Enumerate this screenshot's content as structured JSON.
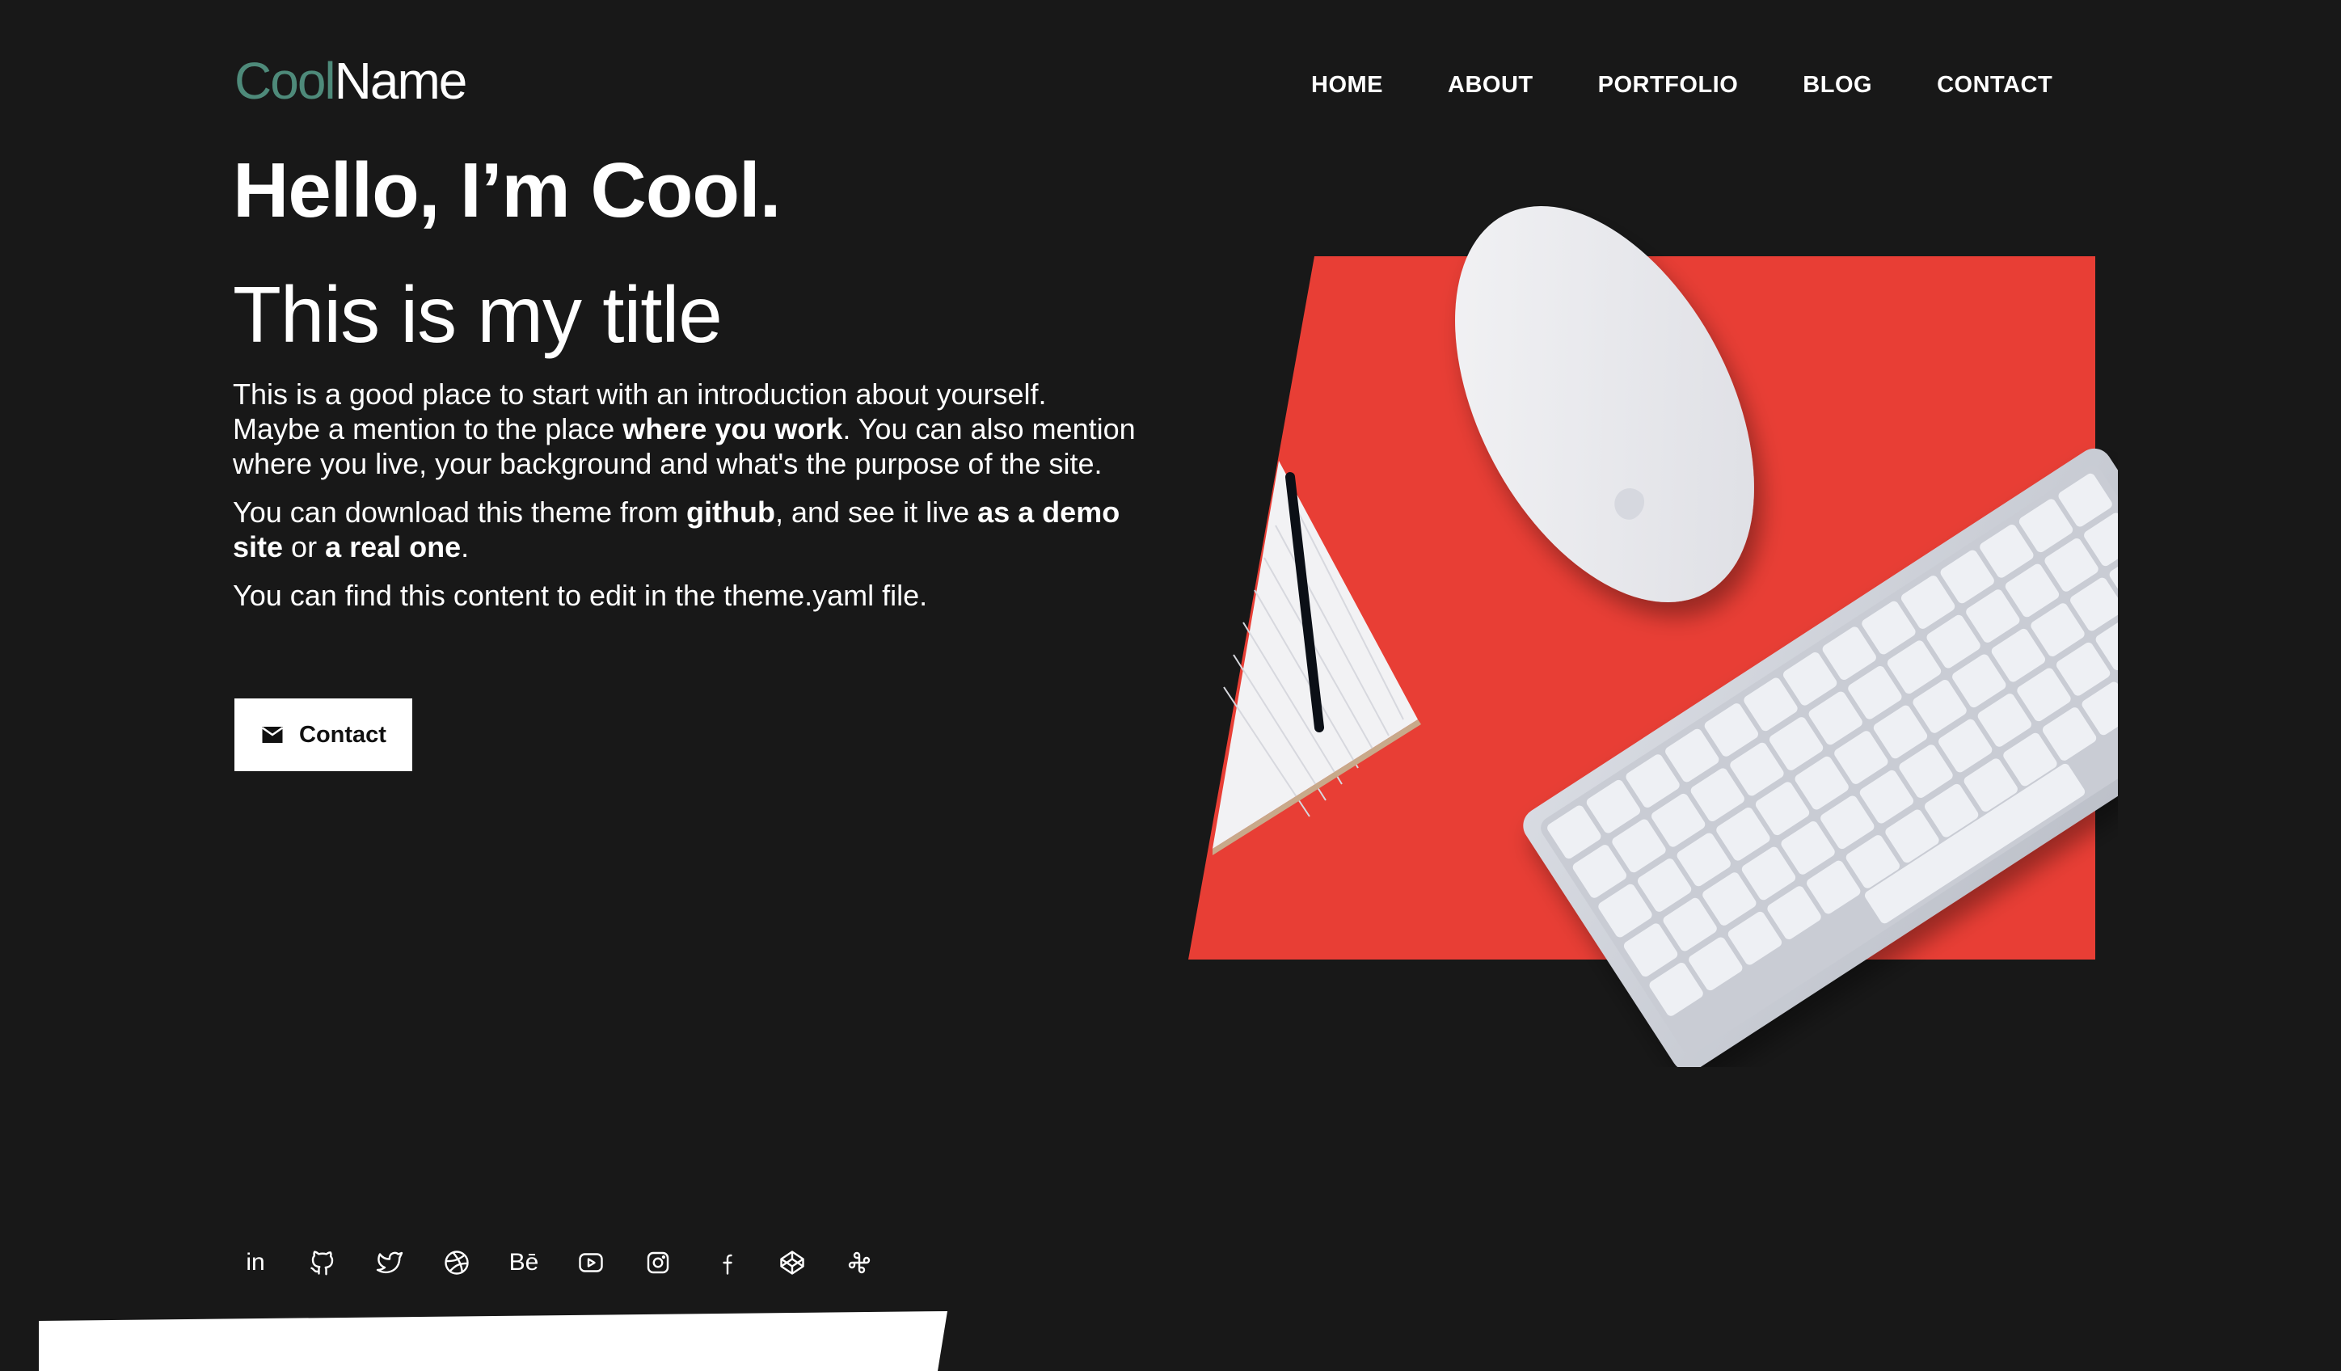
{
  "logo": {
    "part1": "Cool",
    "part2": "Name",
    "color1": "#4e8a7a"
  },
  "nav": {
    "items": [
      {
        "label": "HOME"
      },
      {
        "label": "ABOUT"
      },
      {
        "label": "PORTFOLIO"
      },
      {
        "label": "BLOG"
      },
      {
        "label": "CONTACT"
      }
    ]
  },
  "hero": {
    "greeting": "Hello, I’m Cool.",
    "title": "This is my title",
    "p1": {
      "t1": "This is a good place to start with an introduction about yourself. Maybe a mention to the place ",
      "b1": "where you work",
      "t2": ". You can also mention where you live, your background and what's the purpose of the site."
    },
    "p2": {
      "t1": "You can download this theme from ",
      "b1": "github",
      "t2": ", and see it live ",
      "b2": "as a demo site",
      "t3": " or ",
      "b3": "a real one",
      "t4": "."
    },
    "p3": "You can find this content to edit in the theme.yaml file.",
    "contact_button": "Contact",
    "image_accent": "#e83e35"
  },
  "social": {
    "icons": [
      "linkedin-icon",
      "github-icon",
      "twitter-icon",
      "dribbble-icon",
      "behance-icon",
      "youtube-icon",
      "instagram-icon",
      "facebook-icon",
      "codepen-icon",
      "slack-icon"
    ],
    "linkedin_text": "in",
    "behance_text": "Bē"
  },
  "colors": {
    "background": "#181818",
    "text": "#ffffff"
  }
}
